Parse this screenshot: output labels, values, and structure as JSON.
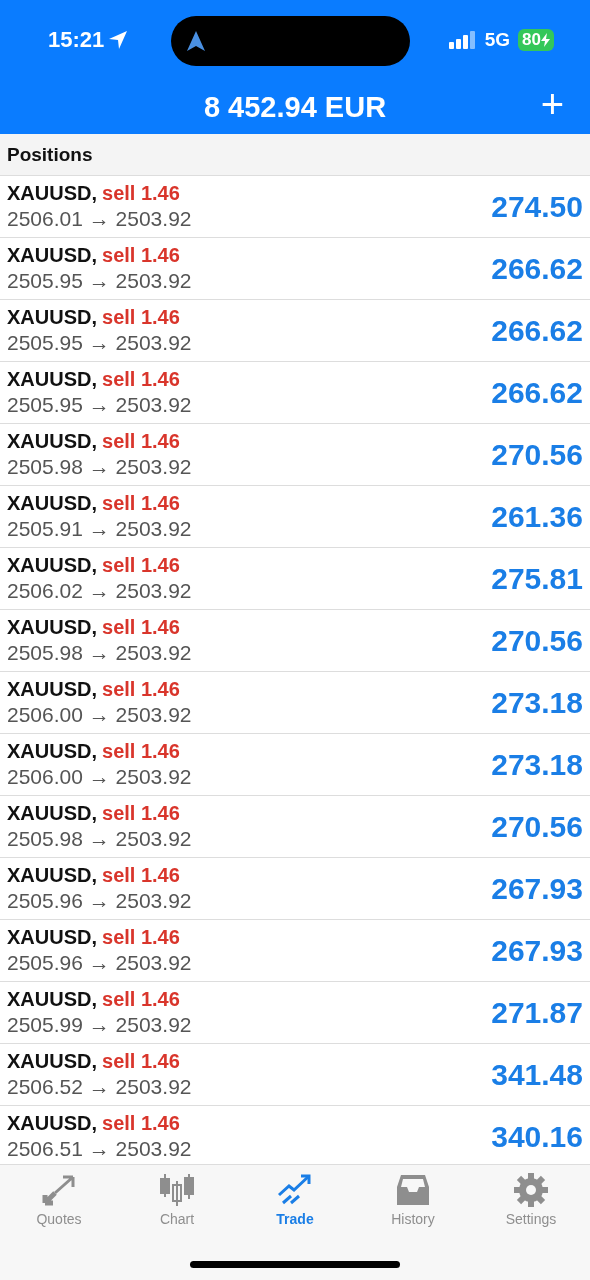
{
  "status_bar": {
    "time": "15:21",
    "network": "5G",
    "battery": "80"
  },
  "header": {
    "balance": "8 452.94 EUR",
    "add_button": "+"
  },
  "section": {
    "title": "Positions"
  },
  "positions": [
    {
      "symbol": "XAUUSD,",
      "side": "sell 1.46",
      "prices": "2506.01 → 2503.92",
      "profit": "274.50"
    },
    {
      "symbol": "XAUUSD,",
      "side": "sell 1.46",
      "prices": "2505.95 → 2503.92",
      "profit": "266.62"
    },
    {
      "symbol": "XAUUSD,",
      "side": "sell 1.46",
      "prices": "2505.95 → 2503.92",
      "profit": "266.62"
    },
    {
      "symbol": "XAUUSD,",
      "side": "sell 1.46",
      "prices": "2505.95 → 2503.92",
      "profit": "266.62"
    },
    {
      "symbol": "XAUUSD,",
      "side": "sell 1.46",
      "prices": "2505.98 → 2503.92",
      "profit": "270.56"
    },
    {
      "symbol": "XAUUSD,",
      "side": "sell 1.46",
      "prices": "2505.91 → 2503.92",
      "profit": "261.36"
    },
    {
      "symbol": "XAUUSD,",
      "side": "sell 1.46",
      "prices": "2506.02 → 2503.92",
      "profit": "275.81"
    },
    {
      "symbol": "XAUUSD,",
      "side": "sell 1.46",
      "prices": "2505.98 → 2503.92",
      "profit": "270.56"
    },
    {
      "symbol": "XAUUSD,",
      "side": "sell 1.46",
      "prices": "2506.00 → 2503.92",
      "profit": "273.18"
    },
    {
      "symbol": "XAUUSD,",
      "side": "sell 1.46",
      "prices": "2506.00 → 2503.92",
      "profit": "273.18"
    },
    {
      "symbol": "XAUUSD,",
      "side": "sell 1.46",
      "prices": "2505.98 → 2503.92",
      "profit": "270.56"
    },
    {
      "symbol": "XAUUSD,",
      "side": "sell 1.46",
      "prices": "2505.96 → 2503.92",
      "profit": "267.93"
    },
    {
      "symbol": "XAUUSD,",
      "side": "sell 1.46",
      "prices": "2505.96 → 2503.92",
      "profit": "267.93"
    },
    {
      "symbol": "XAUUSD,",
      "side": "sell 1.46",
      "prices": "2505.99 → 2503.92",
      "profit": "271.87"
    },
    {
      "symbol": "XAUUSD,",
      "side": "sell 1.46",
      "prices": "2506.52 → 2503.92",
      "profit": "341.48"
    },
    {
      "symbol": "XAUUSD,",
      "side": "sell 1.46",
      "prices": "2506.51 → 2503.92",
      "profit": "340.16"
    }
  ],
  "tabs": [
    {
      "kind": "quotes",
      "label": "Quotes",
      "selected": false
    },
    {
      "kind": "chart",
      "label": "Chart",
      "selected": false
    },
    {
      "kind": "trade",
      "label": "Trade",
      "selected": true
    },
    {
      "kind": "history",
      "label": "History",
      "selected": false
    },
    {
      "kind": "settings",
      "label": "Settings",
      "selected": false
    }
  ]
}
